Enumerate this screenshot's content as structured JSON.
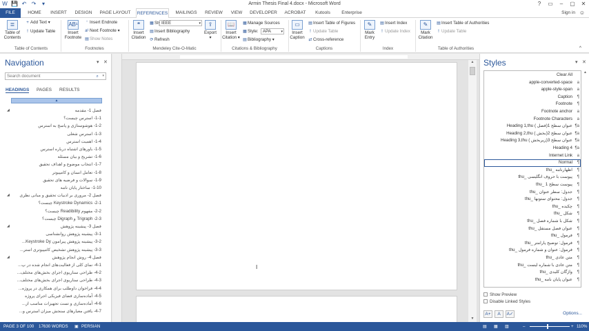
{
  "window": {
    "title": "Armin Thesis Final 4.docx - Microsoft Word",
    "controls": [
      "?",
      "▭",
      "–",
      "▢",
      "✕"
    ]
  },
  "qat": [
    "W",
    "💾",
    "↶",
    "↷",
    "▾"
  ],
  "tabs": [
    {
      "label": "FILE"
    },
    {
      "label": "HOME"
    },
    {
      "label": "INSERT"
    },
    {
      "label": "DESIGN"
    },
    {
      "label": "PAGE LAYOUT"
    },
    {
      "label": "REFERENCES"
    },
    {
      "label": "MAILINGS"
    },
    {
      "label": "REVIEW"
    },
    {
      "label": "VIEW"
    },
    {
      "label": "DEVELOPER"
    },
    {
      "label": "ACROBAT"
    },
    {
      "label": "Kutools"
    },
    {
      "label": "Enterprise"
    }
  ],
  "account": {
    "signin": "Sign in"
  },
  "ribbon": {
    "toc": {
      "big": "Table of Contents",
      "add_text": "Add Text",
      "update_table": "Update Table",
      "group": "Table of Contents"
    },
    "footnotes": {
      "big": "Insert Footnote",
      "insert_endnote": "Insert Endnote",
      "next_footnote": "Next Footnote",
      "show_notes": "Show Notes",
      "group": "Footnotes"
    },
    "mendeley": {
      "insert_citation": "Insert Citation",
      "style_label": "Style:",
      "style_value": "IEEE",
      "insert_bibliography": "Insert Bibliography",
      "refresh": "Refresh",
      "export": "Export",
      "group": "Mendeley Cite-O-Matic"
    },
    "citations": {
      "insert_citation": "Insert Citation",
      "manage_sources": "Manage Sources",
      "style_label": "Style:",
      "style_value": "APA",
      "bibliography": "Bibliography",
      "group": "Citations & Bibliography"
    },
    "captions": {
      "insert_caption": "Insert Caption",
      "insert_tof": "Insert Table of Figures",
      "update_table": "Update Table",
      "cross_reference": "Cross-reference",
      "group": "Captions"
    },
    "index": {
      "mark_entry": "Mark Entry",
      "insert_index": "Insert Index",
      "update_index": "Update Index",
      "group": "Index"
    },
    "authorities": {
      "mark_citation": "Mark Citation",
      "insert_toa": "Insert Table of Authorities",
      "update_table": "Update Table",
      "group": "Table of Authorities"
    }
  },
  "navigation": {
    "title": "Navigation",
    "search_placeholder": "Search document",
    "tabs": [
      "HEADINGS",
      "PAGES",
      "RESULTS"
    ],
    "headings": [
      {
        "text": "فصل 1- مقدمه",
        "level": 1
      },
      {
        "text": "1-1- استرس چیست؟",
        "level": 2
      },
      {
        "text": "1-2- هوشوستاژی و پاسخ به استرس",
        "level": 2
      },
      {
        "text": "1-3- استرس شغلی",
        "level": 2
      },
      {
        "text": "1-4- اهمیت استرس",
        "level": 2
      },
      {
        "text": "1-5- باورهای اشتباه درباره استرس",
        "level": 2
      },
      {
        "text": "1-6- تشریح و بیان مسئله",
        "level": 2
      },
      {
        "text": "1-7- انتخاب موضوع و اهداف تحقیق",
        "level": 2
      },
      {
        "text": "1-8- تعامل انسان و کامپیوتر",
        "level": 2
      },
      {
        "text": "1-9- سوالات و فرضیه های تحقیق",
        "level": 2
      },
      {
        "text": "1-10- ساختار پایان نامه",
        "level": 2
      },
      {
        "text": "فصل 2- مروری بر ادبیات تحقیق و مبانی نظری",
        "level": 1
      },
      {
        "text": "2-1- Keystroke Dynamics چیست؟",
        "level": 2
      },
      {
        "text": "2-2- مفهوم Readibility چیست؟",
        "level": 2
      },
      {
        "text": "2-3- Trigraph و Digraph چیست؟",
        "level": 2
      },
      {
        "text": "فصل 3- پیشینه پژوهش",
        "level": 1
      },
      {
        "text": "3-1- پیشینه پژوهش روانشناسی",
        "level": 2
      },
      {
        "text": "3-2- پیشینه پژوهش پیرامون Keystroke Dy...",
        "level": 2
      },
      {
        "text": "3-3- پیشینه پژوهش تشخیص کامپیوتری استر...",
        "level": 2
      },
      {
        "text": "فصل 4- روش انجام پژوهش",
        "level": 1
      },
      {
        "text": "4-1- نمای کلی از فعالیت‌های انجام شده در پ...",
        "level": 2
      },
      {
        "text": "4-2- طراحی سناریوی اجرای بخش‌های مختلف...",
        "level": 2
      },
      {
        "text": "4-3- طراحی سناریوی اجرای بخش‌های مختلف...",
        "level": 2
      },
      {
        "text": "4-4- فراخوان داوطلب برای همکاری در پروژه...",
        "level": 2
      },
      {
        "text": "4-5- آماده‌سازی فضای فیزیکی اجرای پروژه",
        "level": 2
      },
      {
        "text": "4-6- آماده‌سازی و تست تجهیزات مناسب از...",
        "level": 2
      },
      {
        "text": "4-7- یافتن معیارهای سنجش میزان استرس و...",
        "level": 2
      }
    ]
  },
  "styles": {
    "title": "Styles",
    "items": [
      {
        "name": "Clear All",
        "icon": ""
      },
      {
        "name": "apple-converted-space",
        "icon": "a"
      },
      {
        "name": "apple-style-span",
        "icon": "a"
      },
      {
        "name": "Caption",
        "icon": "¶"
      },
      {
        "name": "Footnote",
        "icon": "¶"
      },
      {
        "name": "Footnote anchor",
        "icon": "a"
      },
      {
        "name": "Footnote Characters",
        "icon": "a"
      },
      {
        "name": "Heading 1,thu عنوان سطح 1(فصل )",
        "icon": "¶a"
      },
      {
        "name": "Heading 2,thu عنوان سطح 2(بخش )",
        "icon": "¶a"
      },
      {
        "name": "Heading 3,thu عنوان سطح 3(زیربخش )",
        "icon": "¶a"
      },
      {
        "name": "Heading 4",
        "icon": "¶a"
      },
      {
        "name": "Internet Link",
        "icon": "a"
      },
      {
        "name": "Normal",
        "icon": "¶"
      },
      {
        "name": "thu_ اظهارنامه",
        "icon": "¶"
      },
      {
        "name": "thu_ پیوست با حروف انگلیسی",
        "icon": "¶"
      },
      {
        "name": "thu_ پیوست سطح 1",
        "icon": "¶"
      },
      {
        "name": "thu_ جدول: سطر عنوان",
        "icon": "¶"
      },
      {
        "name": "thu_ جدول: محتوای ستونها",
        "icon": "¶"
      },
      {
        "name": "thu_ چکیده",
        "icon": "¶"
      },
      {
        "name": "thu_ شکل",
        "icon": "¶"
      },
      {
        "name": "thu_ شکل با شماره فصل",
        "icon": "¶"
      },
      {
        "name": "thu_ عنوان فصل مستقل",
        "icon": "¶"
      },
      {
        "name": "thu_ فرمول",
        "icon": "¶"
      },
      {
        "name": "thu_ فرمول: توضیح پارامتر",
        "icon": "¶"
      },
      {
        "name": "thu_ فرمول: عنوان و شماره فرمول",
        "icon": "¶"
      },
      {
        "name": "thu_ متن عادی",
        "icon": "¶"
      },
      {
        "name": "thu_ متن عادی با شماره لیست",
        "icon": "¶"
      },
      {
        "name": "thu_ واژگان کلیدی",
        "icon": "¶"
      },
      {
        "name": "thu_ عنوان پایان نامه",
        "icon": "¶"
      }
    ],
    "selected": "Normal",
    "show_preview": "Show Preview",
    "disable_linked": "Disable Linked Styles",
    "options": "Options..."
  },
  "status": {
    "page": "PAGE 3 OF 100",
    "words": "17630 WORDS",
    "language": "PERSIAN",
    "zoom": "110%"
  }
}
